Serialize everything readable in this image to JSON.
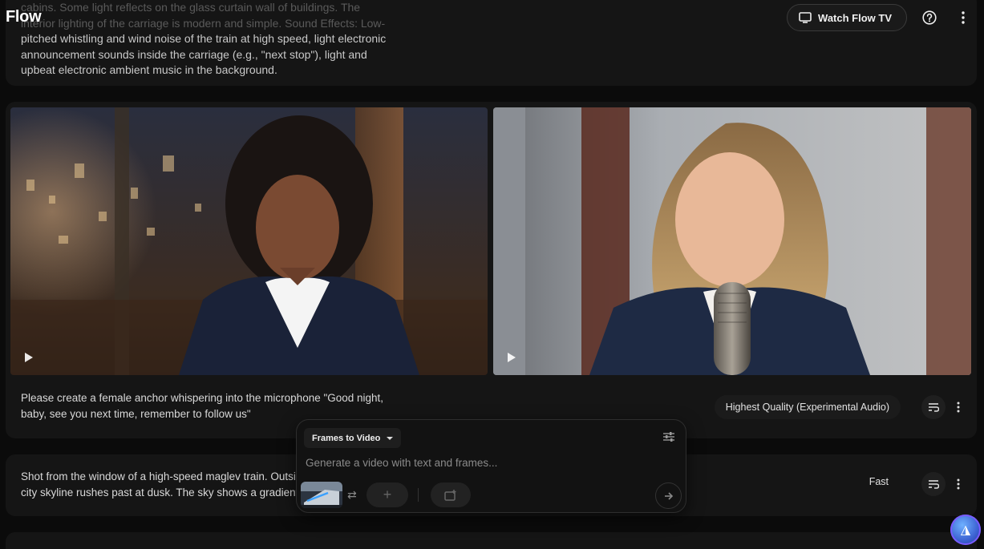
{
  "app": {
    "logo": "Flow"
  },
  "topbar": {
    "watch_label": "Watch Flow TV",
    "help_icon": "help-circle-icon",
    "menu_icon": "more-vert-icon"
  },
  "cards": {
    "top": {
      "prompt_faded": "cabins. Some light reflects on the glass curtain wall of buildings. The interior lighting of the carriage is modern and simple. Sound Effects: Low-",
      "prompt": "pitched whistling and wind noise of the train at high speed, light electronic announcement sounds inside the carriage (e.g., \"next stop\"), light and upbeat electronic ambient music in the background."
    },
    "middle": {
      "prompt": "Please create a female anchor whispering into the microphone \"Good night, baby, see you next time, remember to follow us\"",
      "quality": "Highest Quality (Experimental Audio)"
    },
    "lower": {
      "prompt_line1": "Shot from the window of a high-speed maglev train. Outside,",
      "prompt_line2": "city skyline rushes past at dusk. The sky shows a gradient",
      "quality": "Fast"
    }
  },
  "composer": {
    "mode_label": "Frames to Video",
    "placeholder": "Generate a video with text and frames...",
    "add_symbol": "+"
  },
  "colors": {
    "background": "#0b0b0b",
    "card": "#151515",
    "accent": "#3a5fd0"
  }
}
